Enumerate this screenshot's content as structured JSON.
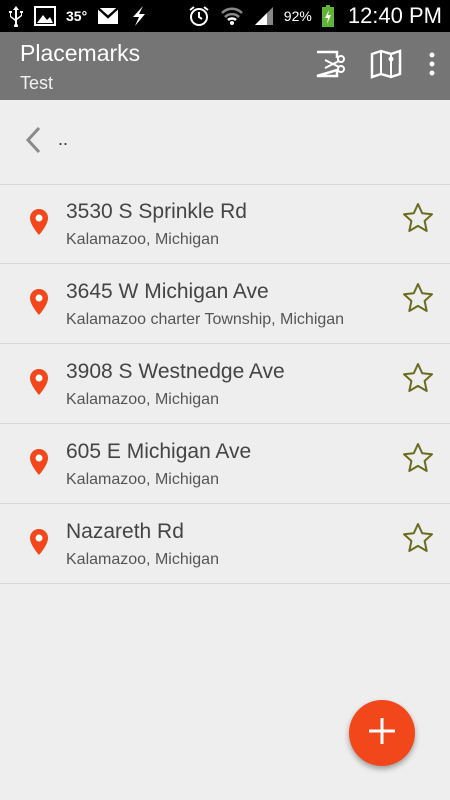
{
  "status_bar": {
    "temperature": "35°",
    "battery_percent": "92%",
    "time": "12:40 PM",
    "icons": [
      "usb-icon",
      "image-icon",
      "gmail-icon",
      "flash-icon",
      "alarm-icon",
      "wifi-icon",
      "signal-icon",
      "battery-charging-icon"
    ]
  },
  "app_bar": {
    "title": "Placemarks",
    "subtitle": "Test",
    "actions": [
      "cut-icon",
      "map-icon",
      "more-vert-icon"
    ]
  },
  "parent_nav": {
    "label": ".."
  },
  "placemarks": [
    {
      "title": "3530 S Sprinkle Rd",
      "subtitle": "Kalamazoo, Michigan"
    },
    {
      "title": "3645 W Michigan Ave",
      "subtitle": "Kalamazoo charter Township, Michigan"
    },
    {
      "title": "3908 S Westnedge Ave",
      "subtitle": "Kalamazoo, Michigan"
    },
    {
      "title": "605 E Michigan Ave",
      "subtitle": "Kalamazoo, Michigan"
    },
    {
      "title": "Nazareth Rd",
      "subtitle": "Kalamazoo, Michigan"
    }
  ],
  "colors": {
    "app_bar": "#757575",
    "pin": "#f2461b",
    "fab": "#f2461b",
    "star_outline": "#6b6b1e"
  }
}
